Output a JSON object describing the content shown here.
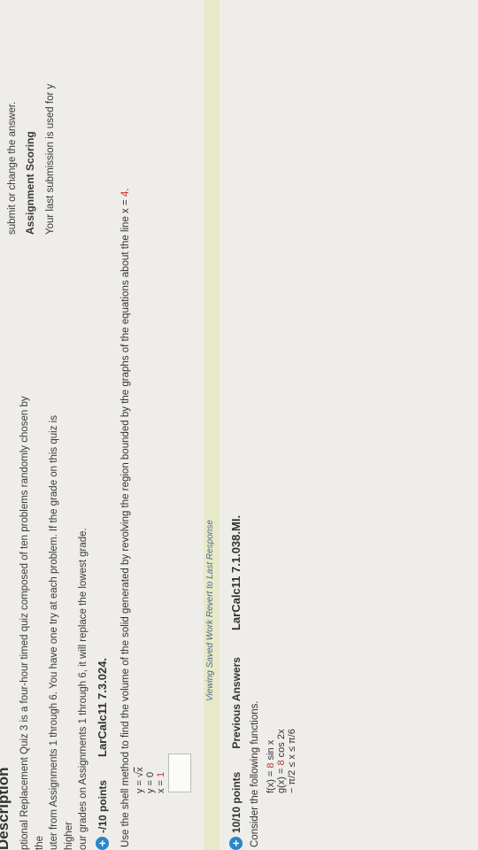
{
  "description": {
    "title": "Description",
    "lines": [
      "ptional Replacement Quiz 3 is a four-hour timed quiz composed of ten problems randomly chosen by the",
      "uter from Assignments 1 through 6. You have one try at each problem. If the grade on this quiz is higher",
      "our grades on Assignments 1 through 6, it will replace the lowest grade."
    ]
  },
  "right_column": {
    "submit_text": "submit or change the answer.",
    "scoring_title": "Assignment Scoring",
    "last_submission": "Your last submission is used for y",
    "chevron_icon": "chevron-up-icon"
  },
  "question1": {
    "points": "-/10 points",
    "id": "LarCalc11 7.3.024.",
    "prompt_main": "Use the shell method to find the volume of the solid generated by revolving the region bounded by the graphs of the equations about the line x = ",
    "prompt_value": "4",
    "prompt_end": ".",
    "equations": [
      {
        "lhs": "y = ",
        "rhs": "x",
        "type": "sqrt"
      },
      {
        "lhs": "y = ",
        "rhs": "0",
        "type": "plain"
      },
      {
        "lhs": "x = ",
        "rhs": "1",
        "type": "accent"
      }
    ],
    "answer_value": "",
    "saved_work_link": "Viewing Saved Work Revert to Last Response"
  },
  "question2": {
    "points": "10/10 points",
    "prev_answers": "Previous Answers",
    "id": "LarCalc11 7.1.038.MI.",
    "prompt": "Consider the following functions.",
    "functions": [
      {
        "lhs": "f(x) = ",
        "num": "8",
        "rest": " sin x"
      },
      {
        "lhs": "g(x) = ",
        "num": "8",
        "rest": " cos 2x"
      },
      {
        "lhs": "−",
        "num": "",
        "rest": " π/2 ≤ x ≤ π/6"
      }
    ]
  },
  "colors": {
    "accent": "#c0392b",
    "plus_badge": "#2a86c9",
    "saved_bar": "#e8e9c8"
  }
}
